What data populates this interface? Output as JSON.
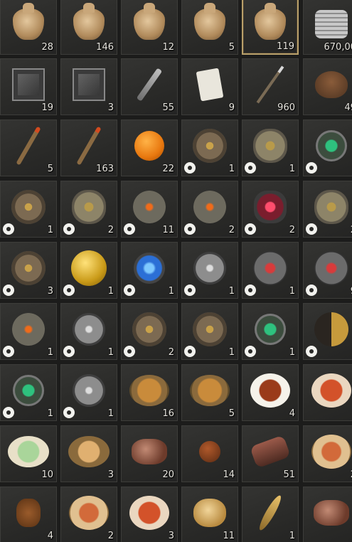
{
  "inventory": {
    "rows": [
      [
        {
          "icon": "coin-pouch-icon",
          "qty": "28"
        },
        {
          "icon": "coin-pouch-icon",
          "qty": "146"
        },
        {
          "icon": "coin-pouch-icon",
          "qty": "12"
        },
        {
          "icon": "coin-pouch-icon",
          "qty": "5"
        },
        {
          "icon": "coin-pouch-icon",
          "qty": "119",
          "selected": true
        },
        {
          "icon": "silver-coins-icon",
          "qty": "670,00"
        }
      ],
      [
        {
          "icon": "metal-cube-icon",
          "qty": "19"
        },
        {
          "icon": "metal-cube-icon",
          "qty": "3"
        },
        {
          "icon": "scepter-icon",
          "qty": "55"
        },
        {
          "icon": "paper-charm-icon",
          "qty": "9"
        },
        {
          "icon": "spear-icon",
          "qty": "960"
        },
        {
          "icon": "leather-bag-icon",
          "qty": "49"
        }
      ],
      [
        {
          "icon": "torch-arrow-icon",
          "qty": "5"
        },
        {
          "icon": "torch-arrow-icon",
          "qty": "163"
        },
        {
          "icon": "orange-fruit-icon",
          "qty": "22"
        },
        {
          "icon": "bronze-gear-icon",
          "qty": "1",
          "badge": true
        },
        {
          "icon": "bronze-disc-icon",
          "qty": "1",
          "badge": true
        },
        {
          "icon": "green-orb-icon",
          "qty": "",
          "badge": true
        }
      ],
      [
        {
          "icon": "bronze-gear-icon",
          "qty": "1",
          "badge": true
        },
        {
          "icon": "bronze-disc-icon",
          "qty": "2",
          "badge": true
        },
        {
          "icon": "lava-stone-icon",
          "qty": "11",
          "badge": true
        },
        {
          "icon": "lava-stone-icon",
          "qty": "2",
          "badge": true
        },
        {
          "icon": "ruby-stone-icon",
          "qty": "2",
          "badge": true
        },
        {
          "icon": "bronze-disc-icon",
          "qty": "2",
          "badge": true
        }
      ],
      [
        {
          "icon": "bronze-gear-icon",
          "qty": "3",
          "badge": true
        },
        {
          "icon": "golden-orb-icon",
          "qty": "1",
          "badge": true
        },
        {
          "icon": "blue-orb-icon",
          "qty": "1",
          "badge": true
        },
        {
          "icon": "steel-emblem-icon",
          "qty": "1",
          "badge": true
        },
        {
          "icon": "red-spiked-orb-icon",
          "qty": "1",
          "badge": true
        },
        {
          "icon": "red-spiked-orb-icon",
          "qty": "9",
          "badge": true
        }
      ],
      [
        {
          "icon": "lava-stone-icon",
          "qty": "1",
          "badge": true
        },
        {
          "icon": "steel-emblem-icon",
          "qty": "1",
          "badge": true
        },
        {
          "icon": "bronze-gear-icon",
          "qty": "2",
          "badge": true
        },
        {
          "icon": "bronze-gear-icon",
          "qty": "1",
          "badge": true
        },
        {
          "icon": "green-orb-icon",
          "qty": "1",
          "badge": true
        },
        {
          "icon": "yin-yang-icon",
          "qty": "",
          "badge": true
        }
      ],
      [
        {
          "icon": "green-orb-icon",
          "qty": "1",
          "badge": true
        },
        {
          "icon": "steel-emblem-icon",
          "qty": "1",
          "badge": true
        },
        {
          "icon": "stew-icon",
          "qty": "16"
        },
        {
          "icon": "stew-icon",
          "qty": "5"
        },
        {
          "icon": "braised-dish-icon",
          "qty": "4"
        },
        {
          "icon": "red-curry-dish-icon",
          "qty": ""
        }
      ],
      [
        {
          "icon": "mochi-plate-icon",
          "qty": "10"
        },
        {
          "icon": "bread-plate-icon",
          "qty": "3"
        },
        {
          "icon": "raw-meat-icon",
          "qty": "20"
        },
        {
          "icon": "meatball-icon",
          "qty": "14"
        },
        {
          "icon": "meat-log-icon",
          "qty": "51"
        },
        {
          "icon": "fish-platter-icon",
          "qty": "2"
        }
      ],
      [
        {
          "icon": "rice-cake-icon",
          "qty": "4"
        },
        {
          "icon": "fried-rice-icon",
          "qty": "2"
        },
        {
          "icon": "tomato-platter-icon",
          "qty": "3"
        },
        {
          "icon": "roast-chicken-icon",
          "qty": "11"
        },
        {
          "icon": "dried-fish-icon",
          "qty": "1"
        },
        {
          "icon": "raw-meat-icon",
          "qty": ""
        }
      ]
    ]
  }
}
